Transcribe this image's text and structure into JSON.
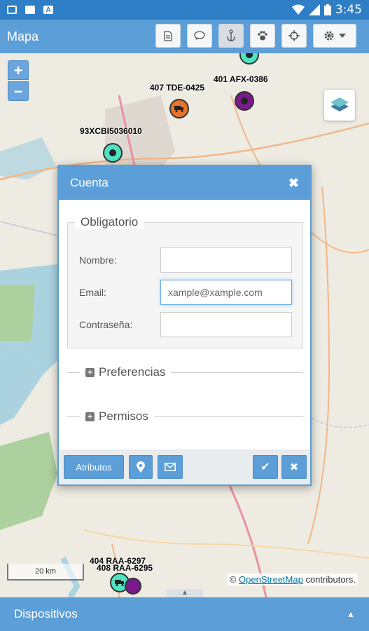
{
  "status_bar": {
    "time": "3:45"
  },
  "toolbar": {
    "title": "Mapa"
  },
  "map": {
    "zoom_in": "+",
    "zoom_out": "−",
    "markers": [
      {
        "label": "407 TDE-0425",
        "color": "#e8732c"
      },
      {
        "label": "401 AFX-0386",
        "color": "#7b1a8c"
      },
      {
        "label": "93XCBI5036010",
        "color": "#4fe3c1"
      },
      {
        "label": "404 RAA-6297",
        "color": "#4fe3c1"
      },
      {
        "label": "408 RAA-6295",
        "color": "#7b1a8c"
      }
    ],
    "scale_label": "20 km",
    "attribution_prefix": "©",
    "attribution_link": "OpenStreetMap",
    "attribution_suffix": "contributors."
  },
  "dialog": {
    "title": "Cuenta",
    "close": "✖",
    "required_legend": "Obligatorio",
    "fields": {
      "name_label": "Nombre:",
      "name_value": "",
      "email_label": "Email:",
      "email_value": "xample@xample.com",
      "password_label": "Contraseña:",
      "password_value": ""
    },
    "sections": [
      "Preferencias",
      "Permisos"
    ],
    "footer": {
      "attributes_label": "Atributos",
      "ok": "✔",
      "cancel": "✖"
    }
  },
  "bottom_panel": {
    "label": "Dispositivos",
    "arrow": "▲"
  },
  "colors": {
    "accent": "#5b9ed8",
    "status_bar": "#2f7fc6"
  }
}
